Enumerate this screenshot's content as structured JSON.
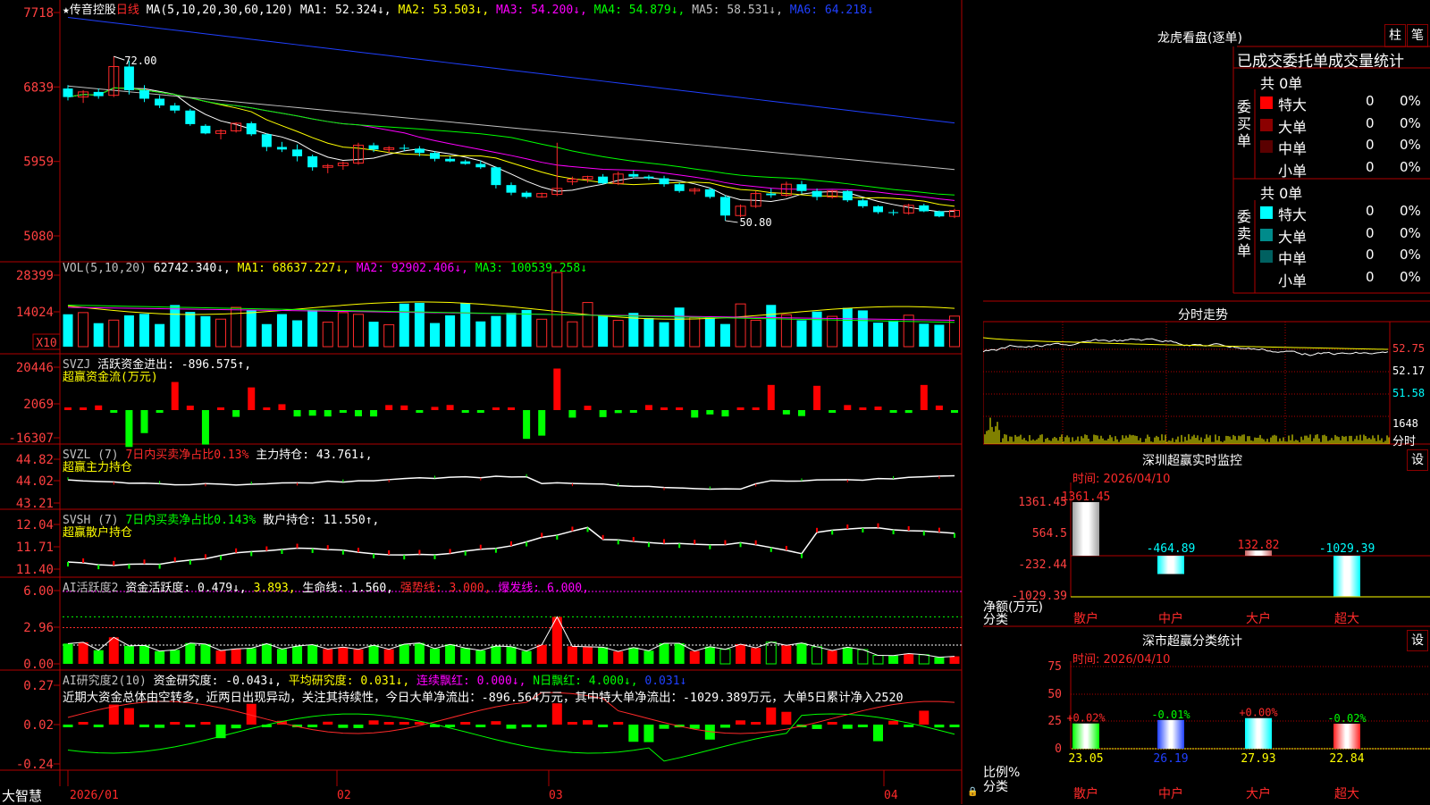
{
  "colors": {
    "up": "#ff2a2a",
    "down": "#00ffff",
    "axis_text": "#ff4040",
    "grid": "#8b0000",
    "ma1": "#ffffff",
    "ma2": "#ffff00",
    "ma3": "#ff00ff",
    "ma4": "#00ff00",
    "ma5": "#c0c0c0",
    "ma6": "#2040ff",
    "pos": "#ff0000",
    "neg": "#00ff00"
  },
  "main": {
    "header": {
      "star": "★",
      "stock_name": "传音控股",
      "period": "日线",
      "ma_label": "MA(5,10,20,30,60,120)",
      "ma1": "MA1: 52.324↓,",
      "ma2": "MA2: 53.503↓,",
      "ma3": "MA3: 54.200↓,",
      "ma4": "MA4: 54.879↓,",
      "ma5": "MA5: 58.531↓,",
      "ma6": "MA6: 64.218↓"
    },
    "price_axis": [
      "7718",
      "6839",
      "5959",
      "5080"
    ],
    "hi_label": "72.00",
    "lo_label": "50.80",
    "vol": {
      "header_label": "VOL(5,10,20)",
      "value": "62742.340↓,",
      "ma1": "MA1: 68637.227↓,",
      "ma2": "MA2: 92902.406↓,",
      "ma3": "MA3: 100539.258↓",
      "axis": [
        "28399",
        "14024"
      ],
      "unit": "X10"
    },
    "svzj": {
      "name": "SVZJ",
      "label": "活跃资金进出: -896.575↑,",
      "sub": "超赢资金流(万元)",
      "axis": [
        "20446",
        "2069",
        "-16307"
      ]
    },
    "svzl": {
      "name": "SVZL (7)",
      "ratio": "7日内买卖净占比0.13%",
      "hold": "主力持仓: 43.761↓,",
      "sub": "超赢主力持仓",
      "axis": [
        "44.82",
        "44.02",
        "43.21"
      ]
    },
    "svsh": {
      "name": "SVSH (7)",
      "ratio": "7日内买卖净占比0.143%",
      "hold": "散户持仓: 11.550↑,",
      "sub": "超赢散户持仓",
      "axis": [
        "12.04",
        "11.71",
        "11.40"
      ]
    },
    "ai2": {
      "name": "AI活跃度2",
      "d1": "资金活跃度: 0.479↓,",
      "d2": "3.893,",
      "d3": "生命线: 1.560,",
      "d4": "强势线: 3.000,",
      "d5": "爆发线: 6.000,",
      "axis": [
        "6.00",
        "2.96",
        "0.00"
      ]
    },
    "air": {
      "name": "AI研究度2(10)",
      "d1": "资金研究度: -0.043↓,",
      "d2": "平均研究度: 0.031↓,",
      "d3": "连续飘红: 0.000↓,",
      "d4": "N日飘红: 4.000↓,",
      "d5": "0.031↓",
      "note": "近期大资金总体由空转多，近两日出现异动，关注其持续性，今日大单净流出：-896.564万元，其中特大单净流出：-1029.389万元，大单5日累计净入2520",
      "axis": [
        "0.27",
        "0.02",
        "-0.24"
      ]
    },
    "footer": {
      "brand": "大智慧",
      "dates": [
        "2026/01",
        "02",
        "03",
        "04"
      ],
      "lock": "🔒"
    }
  },
  "right": {
    "dragon": {
      "title": "龙虎看盘(逐单)",
      "btn1": "柱",
      "btn2": "笔",
      "header": "已成交委托单成交量统计",
      "buy": {
        "label": "委买单",
        "total": "共 0单",
        "rows": [
          {
            "name": "特大",
            "count": "0",
            "pct": "0%",
            "color": "#ff0000"
          },
          {
            "name": "大单",
            "count": "0",
            "pct": "0%",
            "color": "#8b0000"
          },
          {
            "name": "中单",
            "count": "0",
            "pct": "0%",
            "color": "#5a0000"
          },
          {
            "name": "小单",
            "count": "0",
            "pct": "0%",
            "color": "#000000"
          }
        ]
      },
      "sell": {
        "label": "委卖单",
        "total": "共 0单",
        "rows": [
          {
            "name": "特大",
            "count": "0",
            "pct": "0%",
            "color": "#00ffff"
          },
          {
            "name": "大单",
            "count": "0",
            "pct": "0%",
            "color": "#008b8b"
          },
          {
            "name": "中单",
            "count": "0",
            "pct": "0%",
            "color": "#006060"
          },
          {
            "name": "小单",
            "count": "0",
            "pct": "0%",
            "color": "#000000"
          }
        ]
      }
    },
    "intraday": {
      "title": "分时走势",
      "axis": [
        "52.75",
        "52.17",
        "51.58"
      ],
      "vol": "1648",
      "vol_unit": "分时"
    },
    "monitor": {
      "title": "深圳超赢实时监控",
      "btn": "设",
      "time": "时间: 2026/04/10",
      "axis": [
        "1361.45",
        "564.5",
        "-232.44",
        "-1029.39"
      ],
      "unit": "净额(万元)",
      "cat_label": "分类",
      "bars": [
        {
          "name": "散户",
          "value": 1361.45,
          "label": "1361.45"
        },
        {
          "name": "中户",
          "value": -464.89,
          "label": "-464.89"
        },
        {
          "name": "大户",
          "value": 132.82,
          "label": "132.82"
        },
        {
          "name": "超大",
          "value": -1029.39,
          "label": "-1029.39"
        }
      ]
    },
    "classify": {
      "title": "深市超赢分类统计",
      "btn": "设",
      "time": "时间: 2026/04/10",
      "axis": [
        "75",
        "50",
        "25",
        "0"
      ],
      "unit": "比例%",
      "cat_label": "分类",
      "bars": [
        {
          "name": "散户",
          "pct": 23.05,
          "label": "23.05",
          "chg": "+0.02%",
          "color": "#00ff00"
        },
        {
          "name": "中户",
          "pct": 26.19,
          "label": "26.19",
          "chg": "-0.01%",
          "color": "#2040ff"
        },
        {
          "name": "大户",
          "pct": 27.93,
          "label": "27.93",
          "chg": "+0.00%",
          "color": "#00ffff"
        },
        {
          "name": "超大",
          "pct": 22.84,
          "label": "22.84",
          "chg": "-0.02%",
          "color": "#ff2020"
        }
      ]
    }
  },
  "chart_data": {
    "type": "candlestick",
    "dates": [
      "2026/01",
      "02",
      "03",
      "04"
    ],
    "ohlc": [
      [
        68.2,
        68.6,
        66.8,
        67.2
      ],
      [
        67.2,
        68.0,
        66.5,
        67.8
      ],
      [
        67.8,
        68.2,
        67.0,
        67.3
      ],
      [
        67.4,
        72.0,
        67.2,
        70.8
      ],
      [
        70.8,
        71.5,
        67.5,
        68.0
      ],
      [
        68.0,
        68.6,
        66.6,
        67.0
      ],
      [
        67.0,
        67.4,
        65.9,
        66.2
      ],
      [
        66.2,
        66.5,
        65.3,
        65.6
      ],
      [
        65.6,
        65.8,
        63.8,
        64.0
      ],
      [
        63.8,
        64.0,
        62.8,
        62.9
      ],
      [
        62.9,
        63.4,
        62.2,
        63.2
      ],
      [
        63.2,
        64.2,
        63.0,
        64.1
      ],
      [
        64.1,
        64.3,
        62.6,
        62.8
      ],
      [
        62.8,
        62.9,
        60.8,
        61.3
      ],
      [
        61.3,
        61.9,
        60.7,
        61.0
      ],
      [
        61.0,
        61.6,
        59.6,
        60.2
      ],
      [
        60.2,
        60.4,
        58.5,
        58.9
      ],
      [
        58.9,
        59.3,
        58.2,
        59.1
      ],
      [
        59.1,
        59.6,
        58.6,
        59.4
      ],
      [
        59.4,
        61.8,
        59.2,
        61.5
      ],
      [
        61.5,
        61.8,
        60.7,
        61.0
      ],
      [
        61.0,
        61.4,
        60.6,
        61.2
      ],
      [
        61.2,
        61.6,
        60.8,
        61.1
      ],
      [
        61.1,
        61.4,
        60.2,
        60.6
      ],
      [
        60.6,
        60.8,
        59.6,
        59.9
      ],
      [
        59.9,
        60.2,
        59.5,
        59.6
      ],
      [
        59.6,
        59.8,
        59.2,
        59.3
      ],
      [
        59.3,
        59.7,
        58.7,
        58.9
      ],
      [
        58.9,
        59.0,
        56.4,
        56.8
      ],
      [
        56.8,
        57.1,
        55.6,
        55.9
      ],
      [
        55.9,
        56.1,
        55.2,
        55.4
      ],
      [
        55.4,
        55.9,
        55.3,
        55.8
      ],
      [
        55.7,
        61.8,
        55.5,
        56.4
      ],
      [
        57.2,
        57.8,
        56.8,
        57.5
      ],
      [
        57.5,
        57.9,
        57.1,
        57.8
      ],
      [
        57.8,
        58.1,
        56.9,
        57.0
      ],
      [
        57.0,
        58.4,
        56.8,
        58.1
      ],
      [
        58.1,
        58.5,
        57.6,
        57.8
      ],
      [
        57.8,
        58.0,
        57.4,
        57.6
      ],
      [
        57.6,
        57.9,
        56.6,
        56.9
      ],
      [
        56.9,
        57.1,
        55.9,
        56.1
      ],
      [
        56.1,
        56.5,
        55.7,
        56.3
      ],
      [
        56.3,
        56.5,
        55.2,
        55.4
      ],
      [
        55.4,
        55.6,
        52.6,
        53.2
      ],
      [
        53.2,
        54.5,
        53.0,
        54.3
      ],
      [
        54.3,
        56.1,
        54.1,
        55.8
      ],
      [
        55.8,
        56.4,
        55.3,
        55.6
      ],
      [
        55.6,
        57.2,
        55.4,
        56.9
      ],
      [
        56.9,
        57.3,
        55.8,
        56.1
      ],
      [
        56.1,
        56.4,
        55.0,
        55.4
      ],
      [
        55.4,
        56.2,
        55.2,
        56.1
      ],
      [
        56.1,
        56.2,
        54.8,
        55.0
      ],
      [
        55.0,
        55.2,
        54.1,
        54.3
      ],
      [
        54.3,
        54.4,
        53.4,
        53.6
      ],
      [
        53.6,
        53.9,
        53.2,
        53.5
      ],
      [
        53.5,
        54.6,
        53.3,
        54.4
      ],
      [
        54.4,
        54.6,
        53.6,
        53.7
      ],
      [
        53.7,
        53.8,
        53.0,
        53.1
      ],
      [
        53.1,
        54.0,
        52.9,
        53.8
      ]
    ],
    "ma": {
      "MA1": 52.324,
      "MA2": 53.503,
      "MA3": 54.2,
      "MA4": 54.879,
      "MA5": 58.531,
      "MA6": 64.218
    },
    "ylim": [
      50,
      78
    ]
  }
}
